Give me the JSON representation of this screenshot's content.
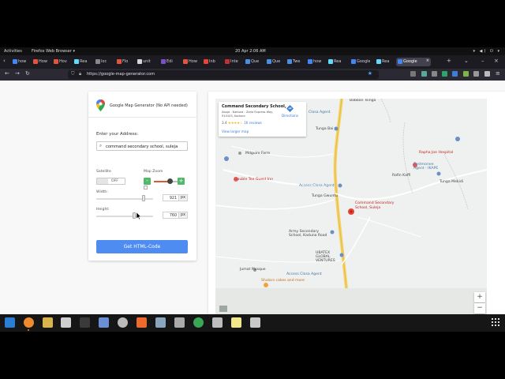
{
  "topbar": {
    "activities": "Activities",
    "app_menu": "Firefox Web Browser ▾",
    "clock": "20 Apr  2:06 AM",
    "sys_icons": "▾ ◀) ⏻ ▾"
  },
  "tabs": [
    {
      "label": "how",
      "color": "#4285f4"
    },
    {
      "label": "How",
      "color": "#e5533d"
    },
    {
      "label": "Hov",
      "color": "#e5533d"
    },
    {
      "label": "Rea",
      "color": "#61dafb"
    },
    {
      "label": "loc",
      "color": "#888888"
    },
    {
      "label": "Flo",
      "color": "#e5533d"
    },
    {
      "label": "unit",
      "color": "#d6d6d6"
    },
    {
      "label": "Edi",
      "color": "#7b4fc9"
    },
    {
      "label": "How",
      "color": "#e5533d"
    },
    {
      "label": "Inb",
      "color": "#ea4335"
    },
    {
      "label": "Inte",
      "color": "#cc2c2c"
    },
    {
      "label": "Que",
      "color": "#4a90e2"
    },
    {
      "label": "Que",
      "color": "#4a90e2"
    },
    {
      "label": "Twe",
      "color": "#4a90e2"
    },
    {
      "label": "how",
      "color": "#4285f4"
    },
    {
      "label": "Rea",
      "color": "#61dafb"
    },
    {
      "label": "Google",
      "color": "#4285f4"
    },
    {
      "label": "Rea",
      "color": "#61dafb"
    },
    {
      "label": "Google",
      "color": "#4285f4",
      "active": true
    }
  ],
  "nav": {
    "url": "https://google-map-generator.com"
  },
  "generator": {
    "title": "Google Map Generator (No API needed)",
    "address_label": "Enter your Address:",
    "address_value": "command secondary school, suleja",
    "satellite_label": "Satellite",
    "satellite_state": "OFF",
    "zoom_label": "Map Zoom",
    "zoom_minus": "-",
    "zoom_plus": "+",
    "width_label": "Width:",
    "width_value": "921",
    "width_unit": "px",
    "width_fraction": 0.83,
    "height_label": "Height:",
    "height_value": "760",
    "height_unit": "px",
    "height_fraction": 0.66,
    "zoom_fraction": 0.65,
    "button": "Get HTML-Code"
  },
  "map": {
    "place_title": "Command Secondary School, ...",
    "place_address": "Abuja - Kaduna - Zaria Express Way, 910103, Kaduna",
    "rating": "3.4",
    "stars": "★★★★☆",
    "reviews": "16 reviews",
    "larger_map": "View larger map",
    "directions": "Directions",
    "zoom_in": "+",
    "zoom_out": "−",
    "labels": {
      "babban_tsinga": "Babban Tsinga",
      "closa_agent_top": "Closa Agent",
      "tunga_bai": "Tunga Bai",
      "mdguire_farm": "Mdguire Farm",
      "double_tee": "Double Tee Guest Inn",
      "access_closa_1": "Access Closa Agent",
      "tunga_gwuntu": "Tunga Gwuntu",
      "command_school": "Command Secondary School, Suleja",
      "rapha_joe": "Rapha Joe Hospital",
      "firstmonee": "Firstmonee Agent - IKAPE",
      "rafin_kaffi": "Rafin Kaffi",
      "tunga_mekidi": "Tunga Mekidi",
      "army_school": "Army Secondary School, Kaduna Road",
      "ubatex": "UBATEX GLOBAL VENTURES",
      "jumat_mosque": "Jumat Mosque",
      "access_closa_2": "Access Closa Agent",
      "shalars": "Shalars cakes and more"
    }
  },
  "dock": {
    "apps": [
      {
        "name": "vscode",
        "color": "#2a7fd4"
      },
      {
        "name": "firefox",
        "color": "#f08a2c",
        "active": true
      },
      {
        "name": "app-yellow",
        "color": "#d8b44a"
      },
      {
        "name": "files",
        "color": "#cfcfcf"
      },
      {
        "name": "terminal",
        "color": "#3a3a3a"
      },
      {
        "name": "app-blue",
        "color": "#6b8fd6"
      },
      {
        "name": "settings",
        "color": "#bbbbbb"
      },
      {
        "name": "app-orange",
        "color": "#f06a2c"
      },
      {
        "name": "app-mixed",
        "color": "#8aa5c0"
      },
      {
        "name": "app-gray",
        "color": "#aaaaaa"
      },
      {
        "name": "chrome",
        "color": "#3aa757"
      },
      {
        "name": "trash",
        "color": "#bdbdbd"
      },
      {
        "name": "notes",
        "color": "#f2e68a"
      },
      {
        "name": "drive",
        "color": "#c8c8c8"
      }
    ]
  }
}
